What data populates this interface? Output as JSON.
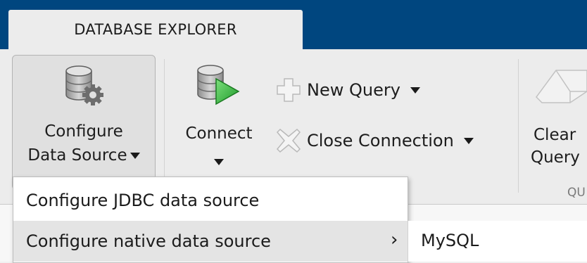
{
  "toolstrip": {
    "tab_label": "DATABASE EXPLORER",
    "configure_button": {
      "line1": "Configure",
      "line2": "Data Source"
    },
    "connect_button": {
      "label": "Connect"
    },
    "new_query_label": "New Query",
    "close_connection_label": "Close Connection",
    "clear_query_button": {
      "line1": "Clear",
      "line2": "Query"
    },
    "section_label_partial": "QU"
  },
  "configure_menu": {
    "items": [
      {
        "label": "Configure JDBC data source"
      },
      {
        "label": "Configure native data source",
        "submenu_arrow": "›"
      }
    ]
  },
  "native_submenu": {
    "items": [
      {
        "label": "MySQL"
      }
    ]
  },
  "colors": {
    "title_bar": "#00467f",
    "ribbon": "#ececec",
    "connect_green": "#3bb13b"
  }
}
